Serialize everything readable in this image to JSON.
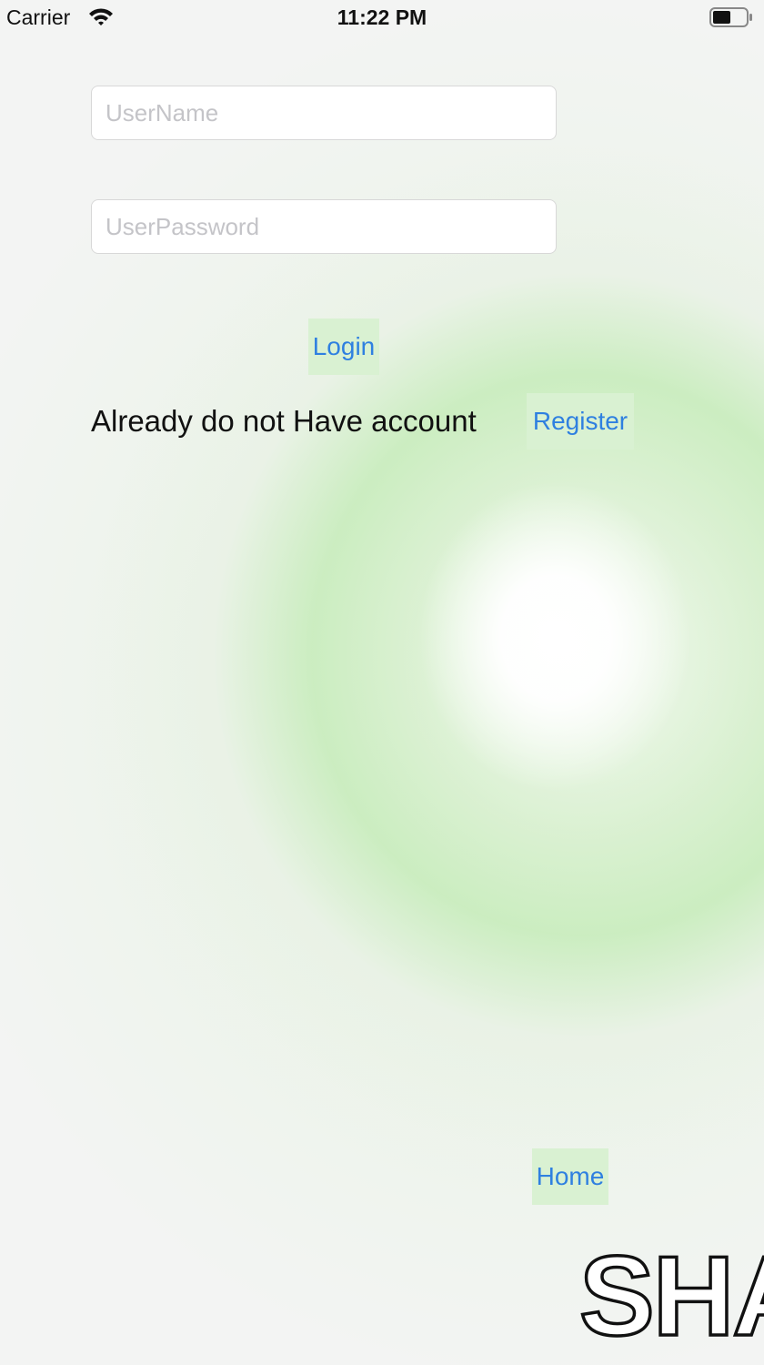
{
  "status_bar": {
    "carrier": "Carrier",
    "time": "11:22 PM",
    "wifi_icon": "wifi-icon",
    "battery_icon": "battery-icon",
    "battery_level": 0.55
  },
  "form": {
    "username": {
      "placeholder": "UserName",
      "value": ""
    },
    "password": {
      "placeholder": "UserPassword",
      "value": ""
    },
    "login_label": "Login"
  },
  "register_prompt": {
    "text": "Already do not Have account",
    "register_label": "Register"
  },
  "home_label": "Home",
  "watermark_text": "SHA",
  "colors": {
    "link": "#2f80e0",
    "button_bg": "#d9f1d2",
    "accent_green": "#c6ecba"
  }
}
